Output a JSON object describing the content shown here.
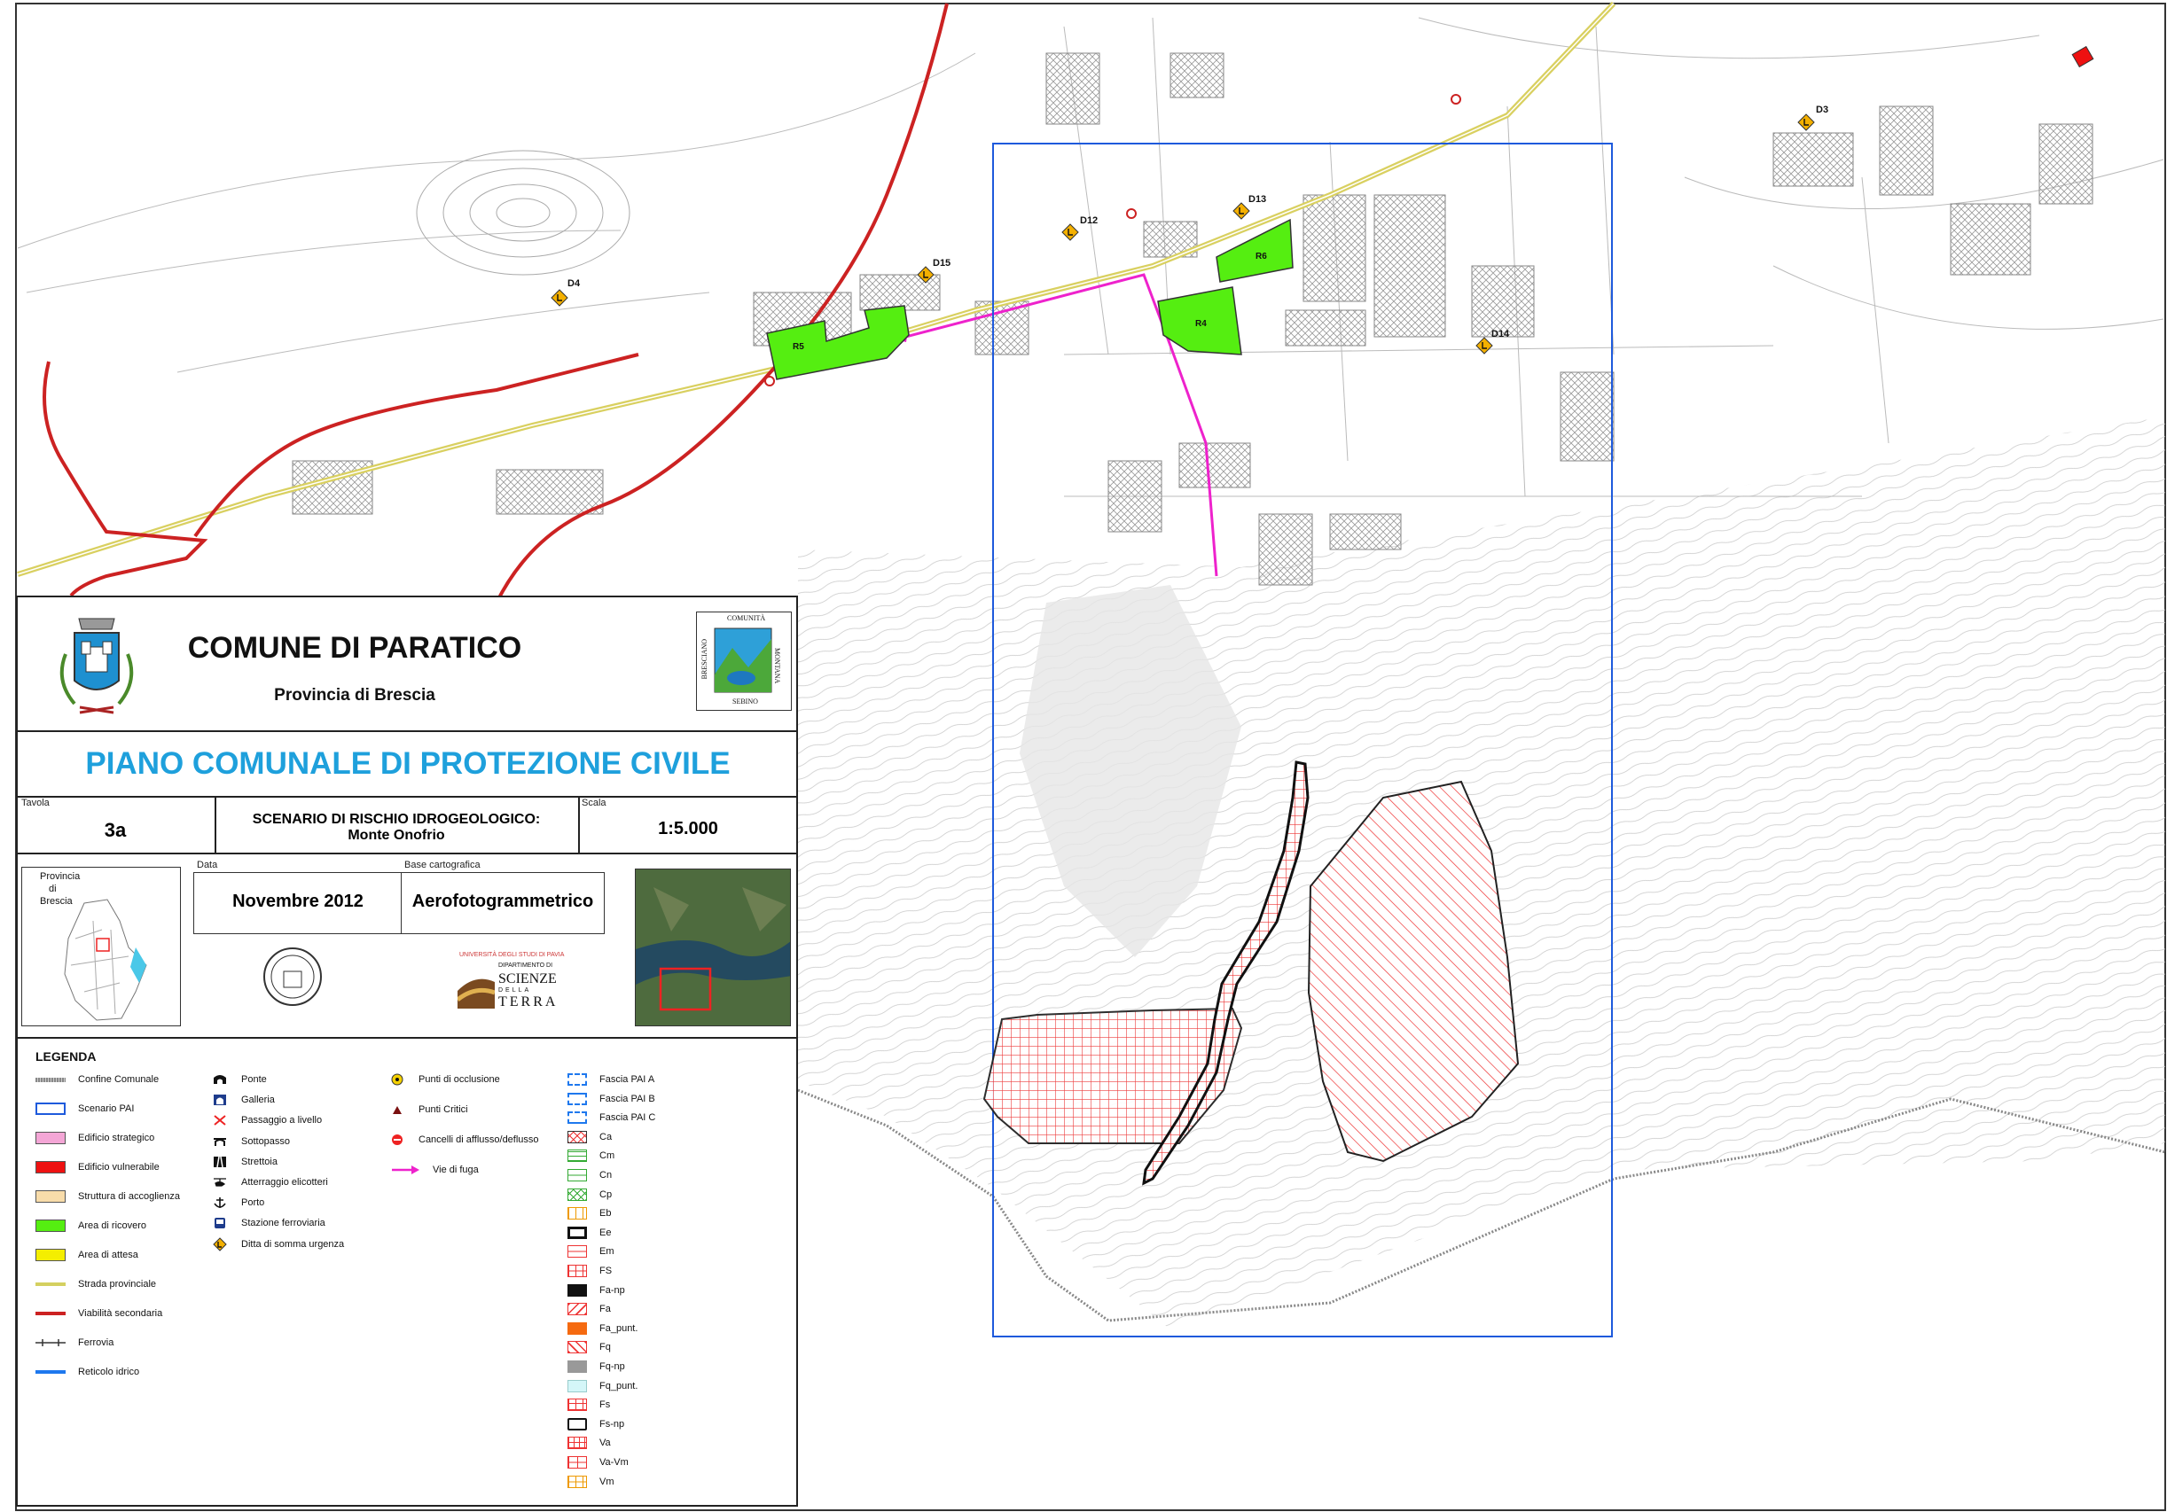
{
  "map": {
    "markers": [
      "D3",
      "D4",
      "D12",
      "D13",
      "D14",
      "D15"
    ],
    "areas": [
      "R4",
      "R5",
      "R6"
    ]
  },
  "header": {
    "municipality": "COMUNE DI PARATICO",
    "province": "Provincia di Brescia",
    "logo_comunita": [
      "COMUNITÀ",
      "MONTANA",
      "SEBINO",
      "BRESCIANO"
    ],
    "plan_title": "PIANO COMUNALE DI PROTEZIONE CIVILE",
    "plan_color": "#1ea0dc"
  },
  "info": {
    "tavola_label": "Tavola",
    "tavola_value": "3a",
    "scenario_line1": "SCENARIO DI RISCHIO IDROGEOLOGICO:",
    "scenario_line2": "Monte Onofrio",
    "scala_label": "Scala",
    "scala_value": "1:5.000",
    "data_label": "Data",
    "data_value": "Novembre 2012",
    "base_label": "Base cartografica",
    "base_value": "Aerofotogrammetrico",
    "inset_label1": "Provincia",
    "inset_label2": "di",
    "inset_label3": "Brescia",
    "university_line1": "UNIVERSITÀ DEGLI STUDI DI PAVIA",
    "university_line2": "DIPARTIMENTO DI",
    "university_line3": "SCIENZE",
    "university_line4": "DELLA",
    "university_line5": "TERRA"
  },
  "legend": {
    "title": "LEGENDA",
    "col1": [
      {
        "label": "Confine Comunale",
        "icon": "border-line",
        "color": "#888888"
      },
      {
        "label": "Scenario PAI",
        "icon": "outline-box",
        "color": "#1e5adc"
      },
      {
        "label": "Edificio strategico",
        "icon": "fill-box",
        "color": "#f4a6d6"
      },
      {
        "label": "Edificio vulnerabile",
        "icon": "fill-box",
        "color": "#ee1111"
      },
      {
        "label": "Struttura di accoglienza",
        "icon": "fill-box",
        "color": "#f8dcaa"
      },
      {
        "label": "Area di ricovero",
        "icon": "fill-box",
        "color": "#55ee11"
      },
      {
        "label": "Area di attesa",
        "icon": "fill-box",
        "color": "#f4ee00"
      },
      {
        "label": "Strada provinciale",
        "icon": "line",
        "color": "#d4d060"
      },
      {
        "label": "Viabilità secondaria",
        "icon": "line",
        "color": "#cc2222"
      },
      {
        "label": "Ferrovia",
        "icon": "rail-line",
        "color": "#333333"
      },
      {
        "label": "Reticolo idrico",
        "icon": "line",
        "color": "#1e78ee"
      }
    ],
    "col2": [
      {
        "label": "Ponte",
        "icon": "bridge-icon"
      },
      {
        "label": "Galleria",
        "icon": "tunnel-icon"
      },
      {
        "label": "Passaggio a livello",
        "icon": "level-crossing-icon"
      },
      {
        "label": "Sottopasso",
        "icon": "underpass-icon"
      },
      {
        "label": "Strettoia",
        "icon": "narrowing-icon"
      },
      {
        "label": "Atterraggio elicotteri",
        "icon": "helicopter-icon"
      },
      {
        "label": "Porto",
        "icon": "anchor-icon"
      },
      {
        "label": "Stazione ferroviaria",
        "icon": "train-station-icon"
      },
      {
        "label": "Ditta di somma urgenza",
        "icon": "warning-diamond-icon"
      }
    ],
    "col3": [
      {
        "label": "Punti di occlusione",
        "icon": "occlusion-icon"
      },
      {
        "label": "Punti Critici",
        "icon": "critical-point-icon"
      },
      {
        "label": "Cancelli di afflusso/deflusso",
        "icon": "gate-icon"
      },
      {
        "label": "Vie di fuga",
        "icon": "escape-arrow-icon",
        "color": "#ee22cc"
      }
    ],
    "col4": [
      {
        "label": "Fascia PAI A",
        "pattern": "dashed-a"
      },
      {
        "label": "Fascia PAI B",
        "pattern": "dashed-b"
      },
      {
        "label": "Fascia PAI C",
        "pattern": "dashed-c"
      },
      {
        "label": "Ca",
        "pattern": "cross-red"
      },
      {
        "label": "Cm",
        "pattern": "hlines-green"
      },
      {
        "label": "Cn",
        "pattern": "hline-green"
      },
      {
        "label": "Cp",
        "pattern": "cross-green"
      },
      {
        "label": "Eb",
        "pattern": "vlines-orange"
      },
      {
        "label": "Ee",
        "pattern": "thick-black"
      },
      {
        "label": "Em",
        "pattern": "hline-red"
      },
      {
        "label": "FS",
        "pattern": "grid-red"
      },
      {
        "label": "Fa-np",
        "pattern": "solid-black"
      },
      {
        "label": "Fa",
        "pattern": "diag-red"
      },
      {
        "label": "Fa_punt.",
        "pattern": "solid-orange"
      },
      {
        "label": "Fq",
        "pattern": "diag2-red"
      },
      {
        "label": "Fq-np",
        "pattern": "solid-grey"
      },
      {
        "label": "Fq_punt.",
        "pattern": "solid-cyan"
      },
      {
        "label": "Fs",
        "pattern": "grid2-red"
      },
      {
        "label": "Fs-np",
        "pattern": "thick-black2"
      },
      {
        "label": "Va",
        "pattern": "grid3-red"
      },
      {
        "label": "Va-Vm",
        "pattern": "grid4-red"
      },
      {
        "label": "Vm",
        "pattern": "grid-orange"
      }
    ]
  }
}
